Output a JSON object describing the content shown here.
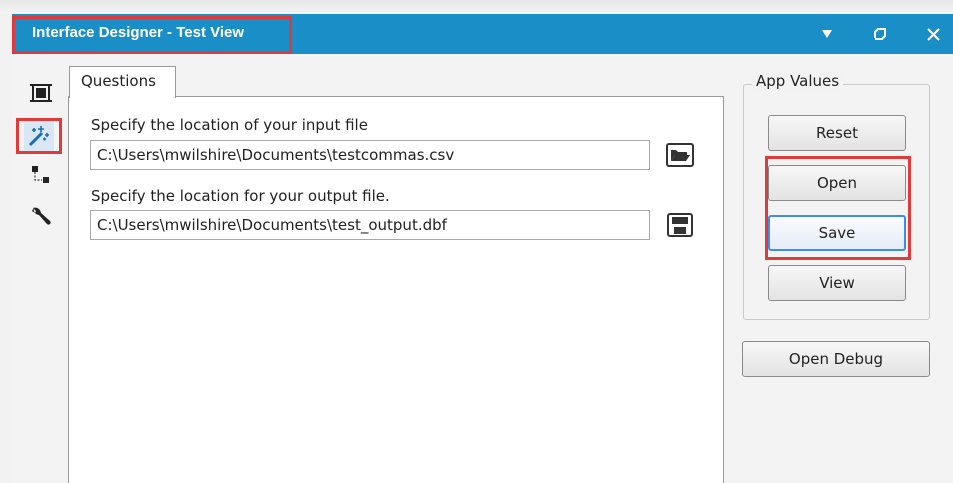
{
  "window": {
    "title": "Interface Designer - Test View",
    "title_bar_color": "#1a8fc7",
    "controls": [
      "dropdown-icon",
      "restore-icon",
      "close-icon"
    ]
  },
  "sidebar": {
    "items": [
      {
        "name": "layout-icon"
      },
      {
        "name": "magic-wand-icon",
        "active": true
      },
      {
        "name": "tree-icon"
      },
      {
        "name": "wrench-icon"
      }
    ]
  },
  "tabs": [
    {
      "label": "Questions"
    }
  ],
  "questions": [
    {
      "label": "Specify the location of your input file",
      "value": "C:\\Users\\mwilshire\\Documents\\testcommas.csv",
      "button_icon": "folder-open-icon"
    },
    {
      "label": "Specify the location for your output file.",
      "value": "C:\\Users\\mwilshire\\Documents\\test_output.dbf",
      "button_icon": "save-disk-icon"
    }
  ],
  "app_values": {
    "title": "App Values",
    "buttons": {
      "reset": "Reset",
      "open": "Open",
      "save": "Save",
      "view": "View"
    }
  },
  "open_debug_label": "Open Debug",
  "highlight_color": "#e03b3b"
}
